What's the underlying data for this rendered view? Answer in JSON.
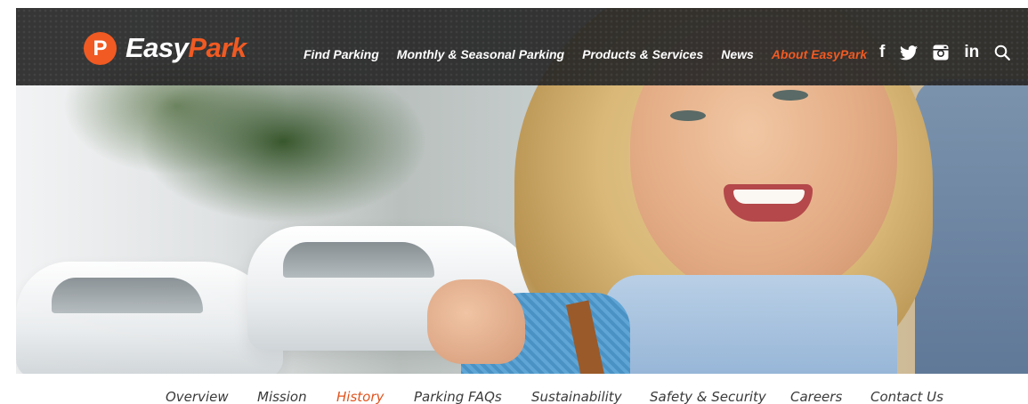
{
  "brand": {
    "badge_letter": "P",
    "name_part1": "Easy",
    "name_part2": "Park",
    "accent_color": "#f15a22"
  },
  "main_nav": {
    "items": [
      {
        "label": "Find Parking",
        "active": false
      },
      {
        "label": "Monthly & Seasonal Parking",
        "active": false
      },
      {
        "label": "Products & Services",
        "active": false
      },
      {
        "label": "News",
        "active": false
      },
      {
        "label": "About EasyPark",
        "active": true
      }
    ]
  },
  "social": {
    "facebook": "f",
    "linkedin": "in",
    "icons": [
      "facebook-icon",
      "twitter-icon",
      "instagram-icon",
      "linkedin-icon",
      "search-icon"
    ]
  },
  "hero": {
    "image": "smiling-woman-in-parking-lot"
  },
  "sub_nav": {
    "items": [
      {
        "label": "Overview",
        "active": false
      },
      {
        "label": "Mission",
        "active": false
      },
      {
        "label": "History",
        "active": true
      },
      {
        "label": "Parking FAQs",
        "active": false
      },
      {
        "label": "Sustainability",
        "active": false
      },
      {
        "label": "Safety & Security",
        "active": false
      },
      {
        "label": "Careers",
        "active": false
      },
      {
        "label": "Contact Us",
        "active": false
      }
    ]
  }
}
